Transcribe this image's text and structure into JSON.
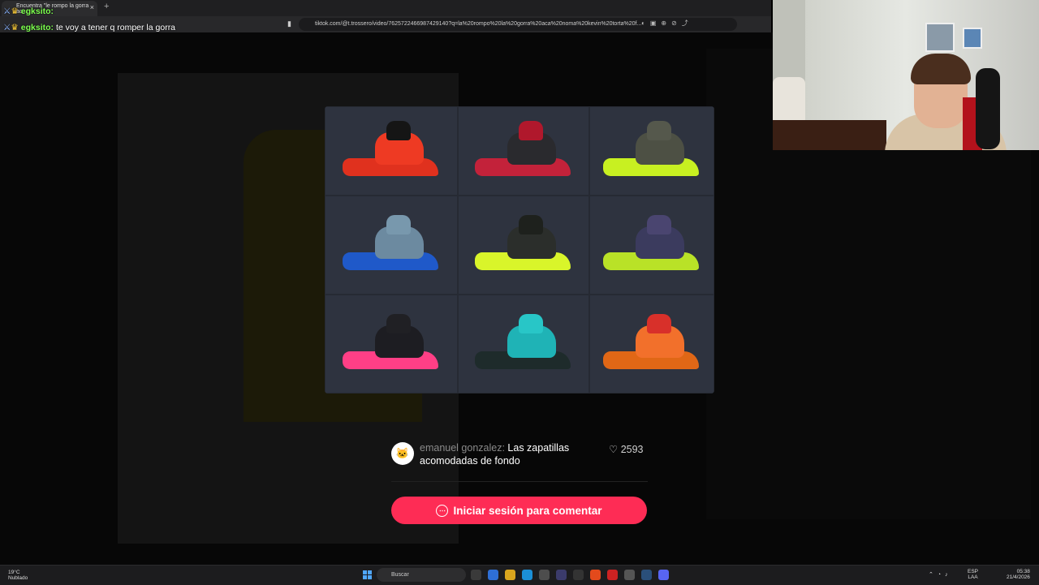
{
  "browser": {
    "tab_title": "Encuentra \"le rompo la gorra ac...",
    "new_tab_symbol": "+",
    "close_symbol": "×",
    "url": "tiktok.com/@t.trossero/video/7625722466987429140?q=la%20rompo%20la%20gorra%20aca%20noma%20kevin%20torta%20f...",
    "bookmark_icon": "bookmark-icon"
  },
  "chat": [
    {
      "user": "egksito:",
      "message": ""
    },
    {
      "user": "egksito:",
      "message": "te voy a tener q romper la gorra"
    }
  ],
  "boots_grid": {
    "items": [
      {
        "label": "red-white-stripes",
        "sole": "#e0311e",
        "upper": "#ee3a23",
        "collar": "#151515"
      },
      {
        "label": "red-black",
        "sole": "#c3223a",
        "upper": "#2a2a2e",
        "collar": "#b0182c"
      },
      {
        "label": "volt-grey-sock",
        "sole": "#c8f021",
        "upper": "#4d5044",
        "collar": "#55584c"
      },
      {
        "label": "teal-blue-sock",
        "sole": "#1f59c9",
        "upper": "#6c8aa0",
        "collar": "#7898ad"
      },
      {
        "label": "black-volt",
        "sole": "#d9f52a",
        "upper": "#2b2e2b",
        "collar": "#1e211d"
      },
      {
        "label": "purple-volt-sock",
        "sole": "#b9e227",
        "upper": "#3b3b5e",
        "collar": "#4a4570"
      },
      {
        "label": "black-pink-sock",
        "sole": "#ff3f86",
        "upper": "#1d1d22",
        "collar": "#202024"
      },
      {
        "label": "turquoise",
        "sole": "#1e2b2b",
        "upper": "#1fb3b6",
        "collar": "#28c6c7"
      },
      {
        "label": "orange-black",
        "sole": "#e06716",
        "upper": "#f2702b",
        "collar": "#d8302a"
      }
    ]
  },
  "comment": {
    "author": "emanuel gonzalez:",
    "text": "Las zapatillas acomodadas de fondo",
    "likes": "2593",
    "avatar_text": "🐱"
  },
  "login_button": {
    "label": "Iniciar sesión para comentar",
    "color": "#fe2c55"
  },
  "taskbar": {
    "weather_temp": "19°C",
    "weather_desc": "Nublado",
    "search_placeholder": "Buscar",
    "lang_top": "ESP",
    "lang_bottom": "LAA",
    "time": "05:38",
    "date": "21/4/2026"
  }
}
